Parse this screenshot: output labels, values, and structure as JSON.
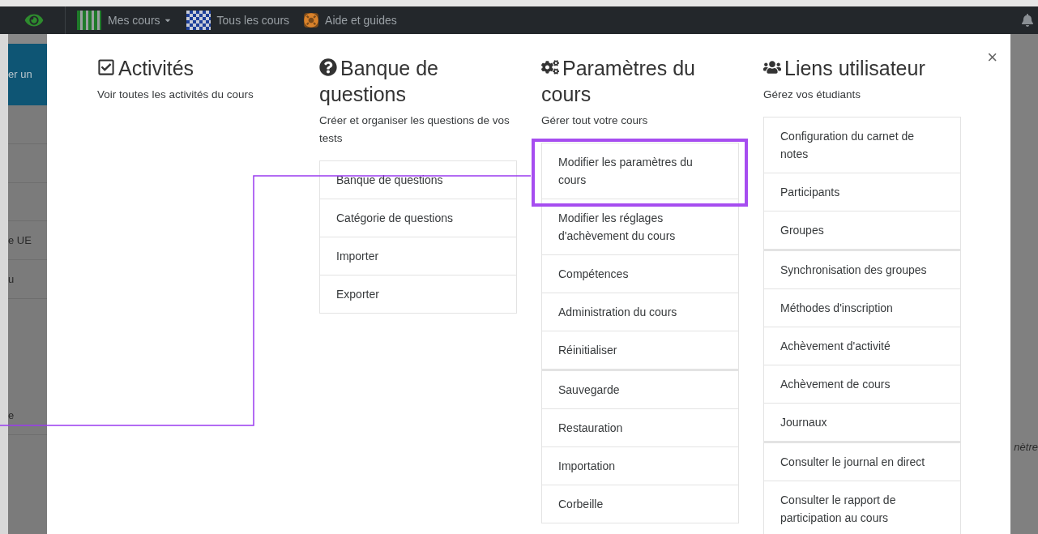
{
  "navbar": {
    "items": [
      {
        "label": "Mes cours",
        "has_menu": true
      },
      {
        "label": "Tous les cours",
        "has_menu": false
      },
      {
        "label": "Aide et guides",
        "has_menu": false
      }
    ]
  },
  "background_page": {
    "banner_fragment": "er un",
    "sidebar_fragments": [
      "e UE",
      "u",
      "e"
    ],
    "right_fragment": "nètre"
  },
  "modal": {
    "sections": [
      {
        "title": "Activités",
        "description": "Voir toutes les activités du cours"
      },
      {
        "title": "Banque de questions",
        "description": "Créer et organiser les questions de vos tests",
        "links": [
          {
            "label": "Banque de questions",
            "highlighted": false,
            "separator_before": false
          },
          {
            "label": "Catégorie de questions",
            "highlighted": false,
            "separator_before": false
          },
          {
            "label": "Importer",
            "highlighted": false,
            "separator_before": false
          },
          {
            "label": "Exporter",
            "highlighted": false,
            "separator_before": false
          }
        ]
      },
      {
        "title": "Paramètres du cours",
        "description": "Gérer tout votre cours",
        "links": [
          {
            "label": "Modifier les paramètres du cours",
            "highlighted": true,
            "separator_before": false
          },
          {
            "label": "Modifier les réglages d'achèvement du cours",
            "highlighted": false,
            "separator_before": false
          },
          {
            "label": "Compétences",
            "highlighted": false,
            "separator_before": false
          },
          {
            "label": "Administration du cours",
            "highlighted": false,
            "separator_before": false
          },
          {
            "label": "Réinitialiser",
            "highlighted": false,
            "separator_before": false
          },
          {
            "label": "Sauvegarde",
            "highlighted": false,
            "separator_before": true
          },
          {
            "label": "Restauration",
            "highlighted": false,
            "separator_before": false
          },
          {
            "label": "Importation",
            "highlighted": false,
            "separator_before": false
          },
          {
            "label": "Corbeille",
            "highlighted": false,
            "separator_before": false
          }
        ]
      },
      {
        "title": "Liens utilisateur",
        "description": "Gérez vos étudiants",
        "links": [
          {
            "label": "Configuration du carnet de notes",
            "highlighted": false,
            "separator_before": false
          },
          {
            "label": "Participants",
            "highlighted": false,
            "separator_before": false
          },
          {
            "label": "Groupes",
            "highlighted": false,
            "separator_before": false
          },
          {
            "label": "Synchronisation des groupes",
            "highlighted": false,
            "separator_before": true
          },
          {
            "label": "Méthodes d'inscription",
            "highlighted": false,
            "separator_before": false
          },
          {
            "label": "Achèvement d'activité",
            "highlighted": false,
            "separator_before": false
          },
          {
            "label": "Achèvement de cours",
            "highlighted": false,
            "separator_before": false
          },
          {
            "label": "Journaux",
            "highlighted": false,
            "separator_before": false
          },
          {
            "label": "Consulter le journal en direct",
            "highlighted": false,
            "separator_before": true
          },
          {
            "label": "Consulter le rapport de participation au cours",
            "highlighted": false,
            "separator_before": false
          }
        ]
      }
    ],
    "close_label": "×"
  }
}
